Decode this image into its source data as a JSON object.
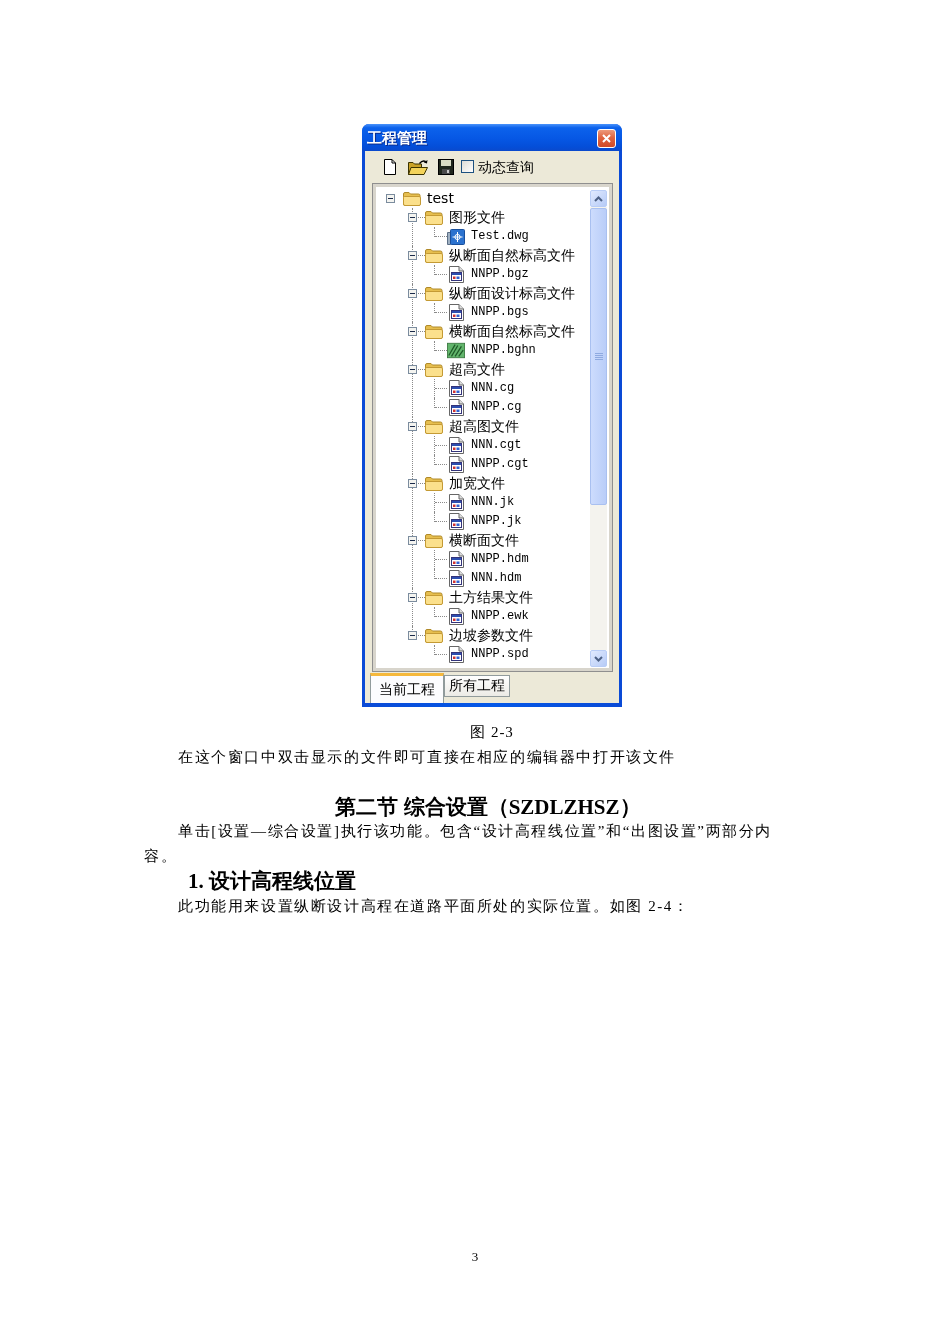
{
  "window": {
    "title": "工程管理"
  },
  "toolbar": {
    "dynamic_query": {
      "label": "动态查询",
      "checked": false
    }
  },
  "tree": [
    {
      "label": "test",
      "kind": "folder",
      "expanded": true,
      "children": [
        {
          "label": "图形文件",
          "kind": "folder",
          "expanded": true,
          "children": [
            {
              "label": "Test.dwg",
              "kind": "drawing"
            }
          ]
        },
        {
          "label": "纵断面自然标高文件",
          "kind": "folder",
          "expanded": true,
          "children": [
            {
              "label": "NNPP.bgz",
              "kind": "document"
            }
          ]
        },
        {
          "label": "纵断面设计标高文件",
          "kind": "folder",
          "expanded": true,
          "children": [
            {
              "label": "NNPP.bgs",
              "kind": "document"
            }
          ]
        },
        {
          "label": "横断面自然标高文件",
          "kind": "folder",
          "expanded": true,
          "children": [
            {
              "label": "NNPP.bghn",
              "kind": "picture"
            }
          ]
        },
        {
          "label": "超高文件",
          "kind": "folder",
          "expanded": true,
          "children": [
            {
              "label": "NNN.cg",
              "kind": "document"
            },
            {
              "label": "NNPP.cg",
              "kind": "document"
            }
          ]
        },
        {
          "label": "超高图文件",
          "kind": "folder",
          "expanded": true,
          "children": [
            {
              "label": "NNN.cgt",
              "kind": "document"
            },
            {
              "label": "NNPP.cgt",
              "kind": "document"
            }
          ]
        },
        {
          "label": "加宽文件",
          "kind": "folder",
          "expanded": true,
          "children": [
            {
              "label": "NNN.jk",
              "kind": "document"
            },
            {
              "label": "NNPP.jk",
              "kind": "document"
            }
          ]
        },
        {
          "label": "横断面文件",
          "kind": "folder",
          "expanded": true,
          "children": [
            {
              "label": "NNPP.hdm",
              "kind": "document"
            },
            {
              "label": "NNN.hdm",
              "kind": "document"
            }
          ]
        },
        {
          "label": "土方结果文件",
          "kind": "folder",
          "expanded": true,
          "children": [
            {
              "label": "NNPP.ewk",
              "kind": "document"
            }
          ]
        },
        {
          "label": "边坡参数文件",
          "kind": "folder",
          "expanded": true,
          "children": [
            {
              "label": "NNPP.spd",
              "kind": "document"
            }
          ]
        }
      ]
    }
  ],
  "tabs": [
    {
      "label": "当前工程",
      "selected": true
    },
    {
      "label": "所有工程",
      "selected": false
    }
  ],
  "document": [
    {
      "kind": "caption",
      "text": "图 2-3"
    },
    {
      "kind": "paragraph",
      "text": "在这个窗口中双击显示的文件即可直接在相应的编辑器中打开该文件"
    },
    {
      "kind": "section_heading",
      "text": "第二节 综合设置（SZDLZHSZ）"
    },
    {
      "kind": "paragraph",
      "text": "单击[设置—综合设置]执行该功能。包含“设计高程线位置”和“出图设置”两部分内容。"
    },
    {
      "kind": "subheading",
      "text": "1. 设计高程线位置"
    },
    {
      "kind": "paragraph",
      "text": "此功能用来设置纵断设计高程在道路平面所处的实际位置。如图 2-4："
    }
  ],
  "page_number": "3"
}
